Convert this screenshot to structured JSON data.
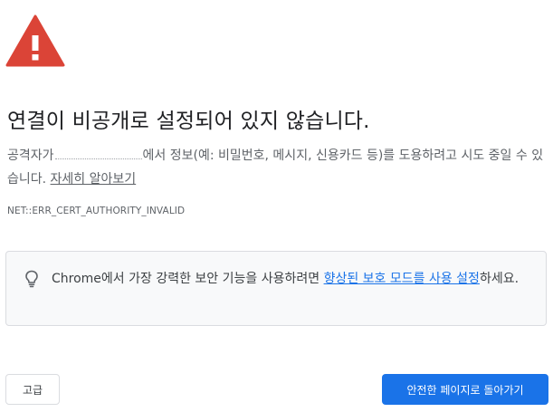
{
  "icons": {
    "warning": "warning-triangle-icon",
    "tip": "lightbulb-icon"
  },
  "colors": {
    "warning_red": "#db4437",
    "link_blue": "#1a73e8",
    "primary_button": "#1a73e8",
    "box_background": "#f8f9fa"
  },
  "heading": "연결이 비공개로 설정되어 있지 않습니다.",
  "body": {
    "prefix": "공격자가",
    "suffix": "에서 정보(예: 비밀번호, 메시지, 신용카드 등)를 도용하려고 시도 중일 수 있습니다. ",
    "learn_more": "자세히 알아보기"
  },
  "error_code": "NET::ERR_CERT_AUTHORITY_INVALID",
  "protection": {
    "text_before": "Chrome에서 가장 강력한 보안 기능을 사용하려면 ",
    "link": "향상된 보호 모드를 사용 설정",
    "text_after": "하세요."
  },
  "buttons": {
    "advanced": "고급",
    "back_to_safety": "안전한 페이지로 돌아가기"
  }
}
